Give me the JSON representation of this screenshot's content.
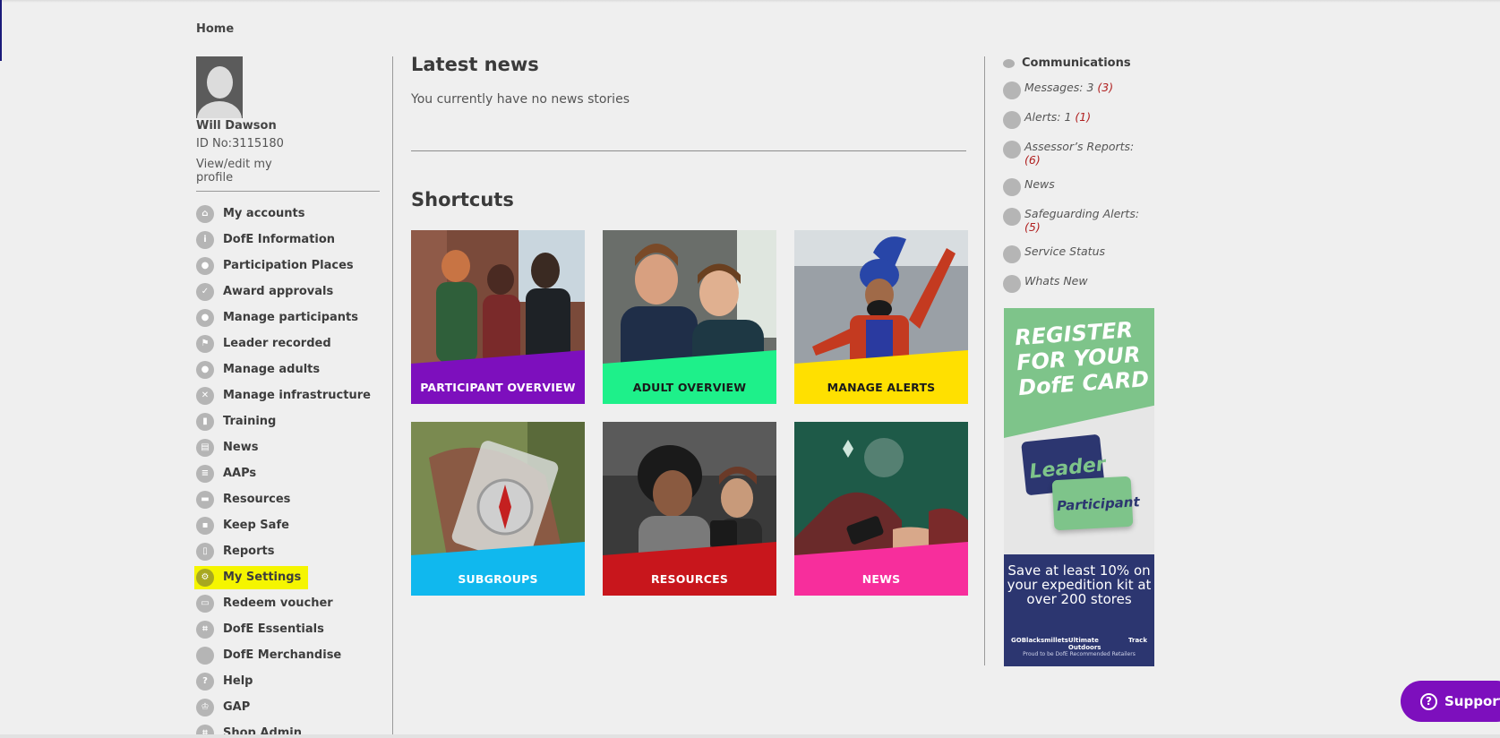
{
  "breadcrumb": "Home",
  "profile": {
    "name": "Will Dawson",
    "id_label": "ID No:3115180",
    "edit_link": "View/edit my profile"
  },
  "nav": [
    {
      "label": "My accounts",
      "icon": "home-icon",
      "glyph": "⌂"
    },
    {
      "label": "DofE Information",
      "icon": "info-icon",
      "glyph": "i"
    },
    {
      "label": "Participation Places",
      "icon": "person-icon",
      "glyph": "●"
    },
    {
      "label": "Award approvals",
      "icon": "shield-icon",
      "glyph": "✓"
    },
    {
      "label": "Manage participants",
      "icon": "people-icon",
      "glyph": "●"
    },
    {
      "label": "Leader recorded",
      "icon": "walker-icon",
      "glyph": "⚑"
    },
    {
      "label": "Manage adults",
      "icon": "adults-icon",
      "glyph": "●"
    },
    {
      "label": "Manage infrastructure",
      "icon": "network-icon",
      "glyph": "✕"
    },
    {
      "label": "Training",
      "icon": "training-icon",
      "glyph": "▮"
    },
    {
      "label": "News",
      "icon": "news-icon",
      "glyph": "▤"
    },
    {
      "label": "AAPs",
      "icon": "list-icon",
      "glyph": "≡"
    },
    {
      "label": "Resources",
      "icon": "folder-icon",
      "glyph": "▬"
    },
    {
      "label": "Keep Safe",
      "icon": "lock-icon",
      "glyph": "▪"
    },
    {
      "label": "Reports",
      "icon": "document-icon",
      "glyph": "▯"
    },
    {
      "label": "My Settings",
      "icon": "gear-icon",
      "glyph": "⚙",
      "highlight": true
    },
    {
      "label": "Redeem voucher",
      "icon": "voucher-icon",
      "glyph": "▭"
    },
    {
      "label": "DofE Essentials",
      "icon": "cart-icon",
      "glyph": "⌗"
    },
    {
      "label": "DofE Merchandise",
      "icon": "merch-icon",
      "glyph": ""
    },
    {
      "label": "Help",
      "icon": "help-icon",
      "glyph": "?"
    },
    {
      "label": "GAP",
      "icon": "gap-icon",
      "glyph": "♔"
    },
    {
      "label": "Shop Admin",
      "icon": "shop-icon",
      "glyph": "⌗"
    }
  ],
  "main": {
    "news_title": "Latest news",
    "no_news": "You currently have no news stories",
    "shortcuts_title": "Shortcuts"
  },
  "shortcuts": [
    {
      "label": "PARTICIPANT OVERVIEW",
      "band": "#7d0fbd",
      "text": "#ffffff"
    },
    {
      "label": "ADULT OVERVIEW",
      "band": "#1ef08a",
      "text": "#1a1a1a"
    },
    {
      "label": "MANAGE ALERTS",
      "band": "#ffe000",
      "text": "#1a1a1a"
    },
    {
      "label": "SUBGROUPS",
      "band": "#10b8ee",
      "text": "#ffffff"
    },
    {
      "label": "RESOURCES",
      "band": "#c8161c",
      "text": "#ffffff"
    },
    {
      "label": "NEWS",
      "band": "#f72e9c",
      "text": "#ffffff"
    }
  ],
  "comms": {
    "title": "Communications",
    "items": [
      {
        "label": "Messages: 3",
        "count": "(3)",
        "icon": "message-icon"
      },
      {
        "label": "Alerts: 1",
        "count": "(1)",
        "icon": "alert-icon"
      },
      {
        "label": "Assessor’s Reports:",
        "count": "(6)",
        "icon": "report-icon",
        "wrap": true
      },
      {
        "label": "News",
        "count": "",
        "icon": "news-icon"
      },
      {
        "label": "Safeguarding Alerts:",
        "count": "(5)",
        "icon": "lock-icon",
        "wrap": true
      },
      {
        "label": "Service Status",
        "count": "",
        "icon": "status-icon"
      },
      {
        "label": "Whats New",
        "count": "",
        "icon": "play-icon"
      }
    ]
  },
  "ad": {
    "headline": "REGISTER FOR YOUR DofE CARD",
    "card_leader": "Leader",
    "card_participant": "Participant",
    "offer": "Save at least 10% on your expedition kit at over 200 stores",
    "logos": [
      "GO",
      "Blacks",
      "millets",
      "Ultimate Outdoors",
      "Track"
    ],
    "footer": "Proud to be DofE Recommended Retailers"
  },
  "support_label": "Support"
}
